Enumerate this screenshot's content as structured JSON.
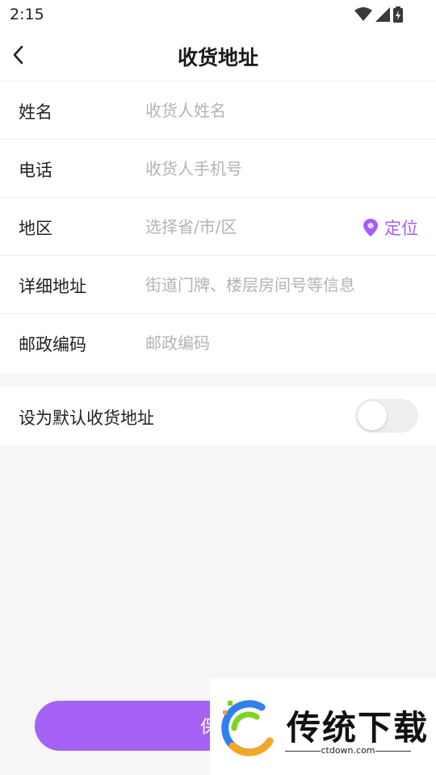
{
  "status_bar": {
    "time": "2:15",
    "icons": [
      "wifi-icon",
      "signal-icon",
      "battery-charging-icon"
    ]
  },
  "header": {
    "back_icon": "chevron-left-icon",
    "title": "收货地址"
  },
  "form": {
    "fields": [
      {
        "label": "姓名",
        "placeholder": "收货人姓名",
        "value": ""
      },
      {
        "label": "电话",
        "placeholder": "收货人手机号",
        "value": ""
      },
      {
        "label": "地区",
        "placeholder": "选择省/市/区",
        "value": ""
      },
      {
        "label": "详细地址",
        "placeholder": "街道门牌、楼层房间号等信息",
        "value": ""
      },
      {
        "label": "邮政编码",
        "placeholder": "邮政编码",
        "value": ""
      }
    ],
    "locate_label": "定位",
    "locate_icon": "location-pin-icon"
  },
  "default_address": {
    "label": "设为默认收货地址",
    "enabled": false
  },
  "save_button": {
    "label": "保存"
  },
  "watermark": {
    "brand": "传统下载",
    "site": "ctdown.com"
  },
  "colors": {
    "accent": "#a65cf6",
    "button": "#a562f5",
    "background": "#f6f6f6",
    "placeholder": "#b3b3b3"
  }
}
